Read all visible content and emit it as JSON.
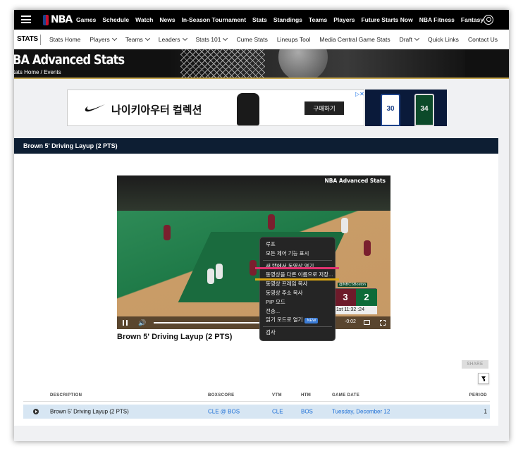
{
  "topnav": {
    "logo_text": "NBA",
    "links": [
      "Games",
      "Schedule",
      "Watch",
      "News",
      "In-Season Tournament",
      "Stats",
      "Standings",
      "Teams",
      "Players",
      "Future Starts Now",
      "NBA Fitness",
      "Fantasy"
    ]
  },
  "subnav": {
    "section": "STATS",
    "links": [
      {
        "label": "Stats Home",
        "dropdown": false
      },
      {
        "label": "Players",
        "dropdown": true
      },
      {
        "label": "Teams",
        "dropdown": true
      },
      {
        "label": "Leaders",
        "dropdown": true
      },
      {
        "label": "Stats 101",
        "dropdown": true
      },
      {
        "label": "Cume Stats",
        "dropdown": false
      },
      {
        "label": "Lineups Tool",
        "dropdown": false
      },
      {
        "label": "Media Central Game Stats",
        "dropdown": false
      },
      {
        "label": "Draft",
        "dropdown": true
      },
      {
        "label": "Quick Links",
        "dropdown": false
      },
      {
        "label": "Contact Us",
        "dropdown": false
      }
    ]
  },
  "banner": {
    "title": "BA Advanced Stats",
    "breadcrumb": "tats Home / Events"
  },
  "ad": {
    "headline": "나이키아우터 컬렉션",
    "cta": "구매하기",
    "jersey_numbers": [
      "30",
      "34"
    ]
  },
  "clip": {
    "header": "Brown 5' Driving Layup (2 PTS)",
    "video_title": "Brown 5' Driving Layup (2 PTS)",
    "watermark": "NBA Advanced Stats",
    "time": "-0:02",
    "scoreboard": {
      "away_score": "3",
      "home_score": "2",
      "network": "@NBCSBoston",
      "clock": "1st 11:32 :24"
    }
  },
  "context_menu": {
    "items": [
      "루프",
      "모든 제어 기능 표시",
      "새 탭에서 동영상 열기",
      "동영상을 다른 이름으로 저장...",
      "동영상 프레임 복사",
      "동영상 주소 복사",
      "PIP 모드",
      "전송...",
      "읽기 모드로 열기",
      "검사"
    ],
    "new_badge": "NEW"
  },
  "share_label": "SHARE",
  "table": {
    "columns": [
      "DESCRIPTION",
      "BOXSCORE",
      "VTM",
      "HTM",
      "GAME DATE",
      "PERIOD"
    ],
    "rows": [
      {
        "description": "Brown 5' Driving Layup (2 PTS)",
        "boxscore": "CLE @ BOS",
        "vtm": "CLE",
        "htm": "BOS",
        "game_date": "Tuesday, December 12",
        "period": "1"
      }
    ]
  }
}
